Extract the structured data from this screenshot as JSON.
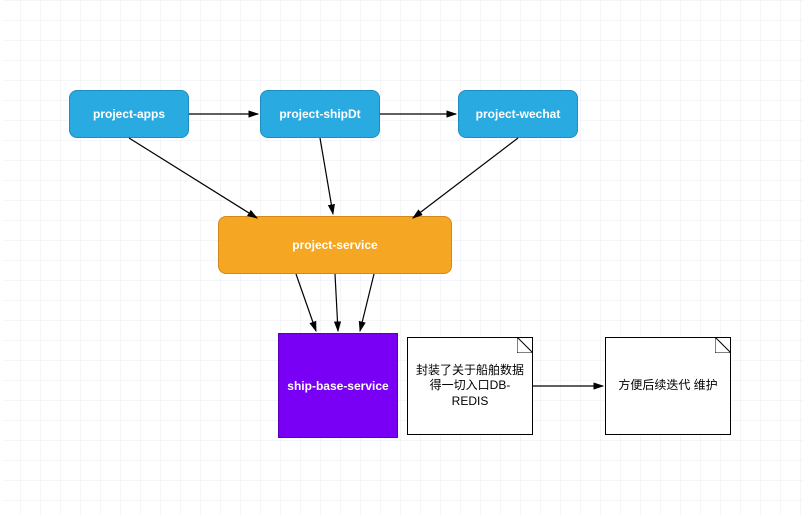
{
  "nodes": {
    "apps": {
      "label": "project-apps"
    },
    "shipdt": {
      "label": "project-shipDt"
    },
    "wechat": {
      "label": "project-wechat"
    },
    "service": {
      "label": "project-service"
    },
    "base": {
      "label": "ship-base-service"
    }
  },
  "notes": {
    "n1": {
      "text": "封装了关于船舶数据得一切入口DB-REDIS"
    },
    "n2": {
      "text": "方便后续迭代 维护"
    }
  },
  "colors": {
    "blue": "#29abe2",
    "orange": "#f5a623",
    "purple": "#7a00f5"
  }
}
